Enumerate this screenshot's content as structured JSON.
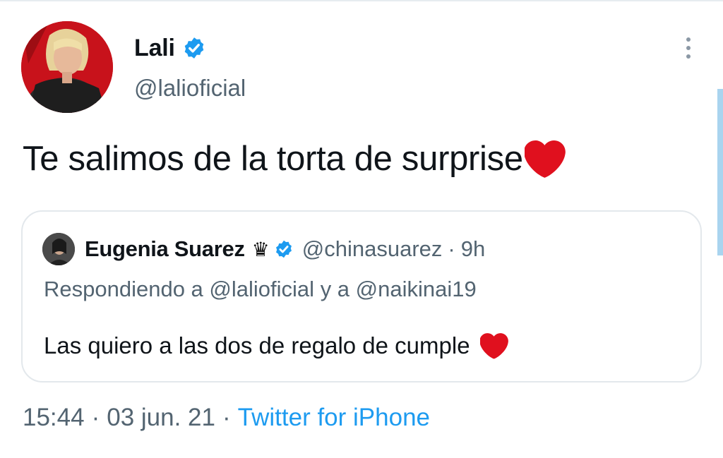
{
  "tweet": {
    "author": {
      "name": "Lali",
      "handle": "@lalioficial",
      "verified": true,
      "avatar_icon": "avatar-photo"
    },
    "text": "Te salimos de la torta de surprise",
    "text_emoji": "heart-emoji",
    "more_icon": "more-vertical-icon",
    "quoted": {
      "name": "Eugenia Suarez",
      "name_emoji": "♛",
      "verified": true,
      "handle": "@chinasuarez",
      "separator": "·",
      "time": "9h",
      "reply_prefix": "Respondiendo a",
      "reply_mention_1": "@lalioficial",
      "reply_joiner": "y a",
      "reply_mention_2": "@naikinai19",
      "text": "Las quiero a las dos de regalo de cumple",
      "text_emoji": "heart-emoji"
    },
    "meta": {
      "time": "15:44",
      "separator": "·",
      "date": "03 jun. 21",
      "source": "Twitter for iPhone"
    }
  },
  "colors": {
    "verified": "#1d9bf0",
    "heart": "#e0101e",
    "secondary_text": "#536471",
    "link": "#1d9bf0"
  }
}
